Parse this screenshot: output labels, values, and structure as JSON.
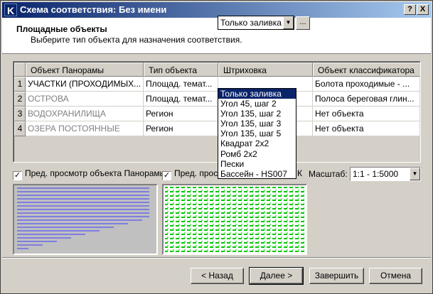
{
  "window": {
    "title": "Схема соответствия: Без имени",
    "app_icon_letter": "K",
    "help_btn": "?",
    "close_btn": "X"
  },
  "header": {
    "title": "Площадные объекты",
    "subtitle": "Выберите тип объекта для назначения соответствия."
  },
  "grid": {
    "columns": [
      "Объект Панорамы",
      "Тип объекта",
      "Штриховка",
      "Объект классификатора"
    ],
    "rows": [
      {
        "num": "1",
        "object": "УЧАСТКИ (ПРОХОДИМЫХ...",
        "type": "Площад. темат...",
        "hatch": "Только заливка",
        "classifier": "Болота проходимые - ..."
      },
      {
        "num": "2",
        "object": "ОСТРОВА",
        "type": "Площад. темат...",
        "hatch": "",
        "classifier": "Полоса береговая глин..."
      },
      {
        "num": "3",
        "object": "ВОДОХРАНИЛИЩА",
        "type": "Регион",
        "hatch": "",
        "classifier": "Нет объекта"
      },
      {
        "num": "4",
        "object": "ОЗЕРА ПОСТОЯННЫЕ",
        "type": "Регион",
        "hatch": "",
        "classifier": "Нет объекта"
      }
    ],
    "ellipsis": "..."
  },
  "dropdown": {
    "options": [
      "Только заливка",
      "Угол 45, шаг 2",
      "Угол 135, шаг 2",
      "Угол 135, шаг 3",
      "Угол 135, шаг 5",
      "Квадрат 2x2",
      "Ромб 2x2",
      "Пески",
      "Бассейн - HS007"
    ],
    "selected_index": 0
  },
  "options": {
    "preview_panorama": "Пред. просмотр объекта Панорамы",
    "preview_other": "Пред. просм",
    "preview_other_tail": "К",
    "scale_label": "Масштаб:",
    "scale_value": "1:1 - 1:5000"
  },
  "buttons": {
    "back": "< Назад",
    "next": "Далее >",
    "finish": "Завершить",
    "cancel": "Отмена"
  },
  "colors": {
    "titlebar": "#0a246a",
    "preview1_lines": "#3b3bff",
    "preview2_hatch": "#00c800"
  }
}
